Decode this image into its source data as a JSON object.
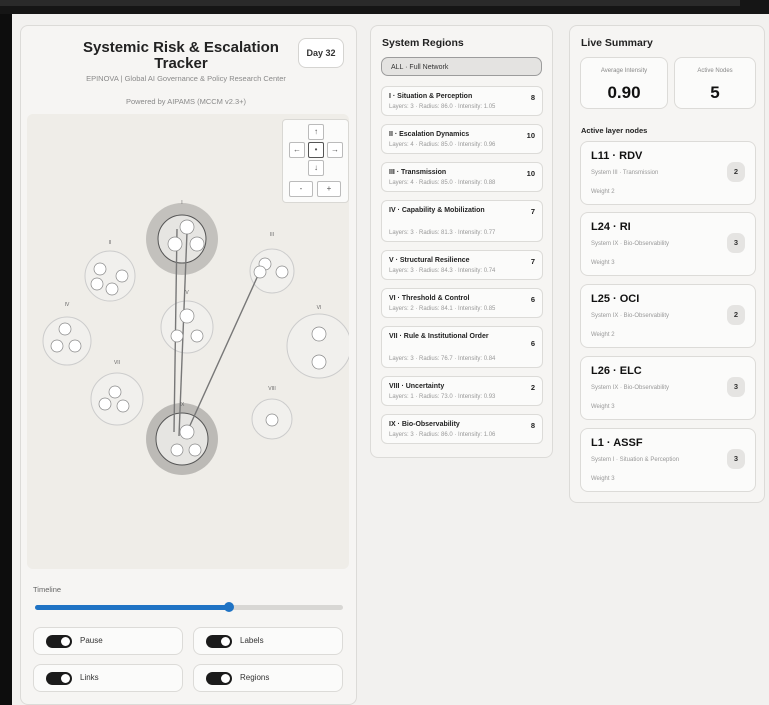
{
  "left": {
    "title": "Systemic Risk & Escalation Tracker",
    "day": "Day 32",
    "org": "EPINOVA | Global AI Governance & Policy Research Center",
    "powered": "Powered by AIPAMS (MCCM v2.3+)",
    "nav": {
      "up": "↑",
      "down": "↓",
      "left": "←",
      "right": "→",
      "center": "•",
      "zoom_out": "-",
      "zoom_in": "+"
    },
    "timeline_label": "Timeline",
    "timeline_progress": 0.63,
    "toggles": {
      "pause": "Pause",
      "labels": "Labels",
      "links": "Links",
      "regions": "Regions"
    },
    "network_labels": {
      "I": "I",
      "II": "II",
      "III": "III",
      "IV": "IV",
      "V": "V",
      "VI": "VI",
      "VII": "VII",
      "VIII": "VIII",
      "IX": "IX"
    }
  },
  "regions": {
    "header": "System Regions",
    "all": "ALL · Full Network",
    "items": [
      {
        "name": "I · Situation & Perception",
        "count": "8",
        "meta": "Layers: 3 · Radius: 86.0 · Intensity: 1.05"
      },
      {
        "name": "II · Escalation Dynamics",
        "count": "10",
        "meta": "Layers: 4 · Radius: 85.0 · Intensity: 0.96"
      },
      {
        "name": "III · Transmission",
        "count": "10",
        "meta": "Layers: 4 · Radius: 85.0 · Intensity: 0.88"
      },
      {
        "name": "IV · Capability & Mobilization",
        "count": "7",
        "meta": "Layers: 3 · Radius: 81.3 · Intensity: 0.77"
      },
      {
        "name": "V · Structural Resilience",
        "count": "7",
        "meta": "Layers: 3 · Radius: 84.3 · Intensity: 0.74"
      },
      {
        "name": "VI · Threshold & Control",
        "count": "6",
        "meta": "Layers: 2 · Radius: 84.1 · Intensity: 0.85"
      },
      {
        "name": "VII · Rule & Institutional Order",
        "count": "6",
        "meta": "Layers: 3 · Radius: 76.7 · Intensity: 0.84"
      },
      {
        "name": "VIII · Uncertainty",
        "count": "2",
        "meta": "Layers: 1 · Radius: 73.0 · Intensity: 0.93"
      },
      {
        "name": "IX · Bio-Observability",
        "count": "8",
        "meta": "Layers: 3 · Radius: 86.0 · Intensity: 1.06"
      }
    ]
  },
  "summary": {
    "header": "Live Summary",
    "avg_label": "Average Intensity",
    "avg_value": "0.90",
    "active_label": "Active Nodes",
    "active_value": "5",
    "layer_header": "Active layer nodes",
    "nodes": [
      {
        "title": "L11 · RDV",
        "system": "System III · Transmission",
        "weight": "Weight 2",
        "badge": "2"
      },
      {
        "title": "L24 · RI",
        "system": "System IX · Bio-Observability",
        "weight": "Weight 3",
        "badge": "3"
      },
      {
        "title": "L25 · OCI",
        "system": "System IX · Bio-Observability",
        "weight": "Weight 2",
        "badge": "2"
      },
      {
        "title": "L26 · ELC",
        "system": "System IX · Bio-Observability",
        "weight": "Weight 3",
        "badge": "3"
      },
      {
        "title": "L1 · ASSF",
        "system": "System I · Situation & Perception",
        "weight": "Weight 3",
        "badge": "3"
      }
    ]
  },
  "colors": {
    "accent": "#1f73c4",
    "toggle_on": "#1b1b1b",
    "panel_bg": "#f6f5f3"
  }
}
